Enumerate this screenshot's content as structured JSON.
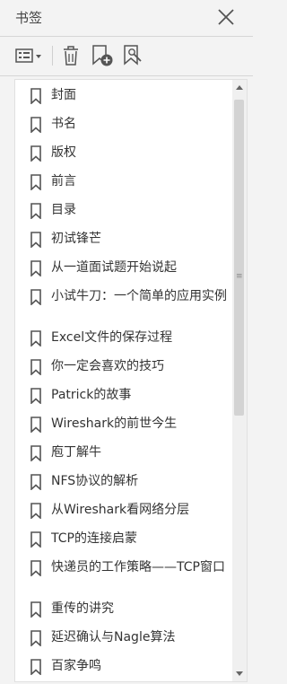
{
  "panel": {
    "title": "书签"
  },
  "toolbar": {
    "options_icon": "list-options-icon",
    "delete_icon": "trash-icon",
    "add_icon": "bookmark-add-icon",
    "find_icon": "bookmark-search-icon"
  },
  "bookmarks": [
    "封面",
    "书名",
    "版权",
    "前言",
    "目录",
    "初试锋芒",
    "从一道面试题开始说起",
    "小试牛刀：一个简单的应用实例",
    "Excel文件的保存过程",
    "你一定会喜欢的技巧",
    "Patrick的故事",
    "Wireshark的前世今生",
    "庖丁解牛",
    "NFS协议的解析",
    "从Wireshark看网络分层",
    "TCP的连接启蒙",
    "快递员的工作策略——TCP窗口",
    "重传的讲究",
    "延迟确认与Nagle算法",
    "百家争鸣"
  ]
}
